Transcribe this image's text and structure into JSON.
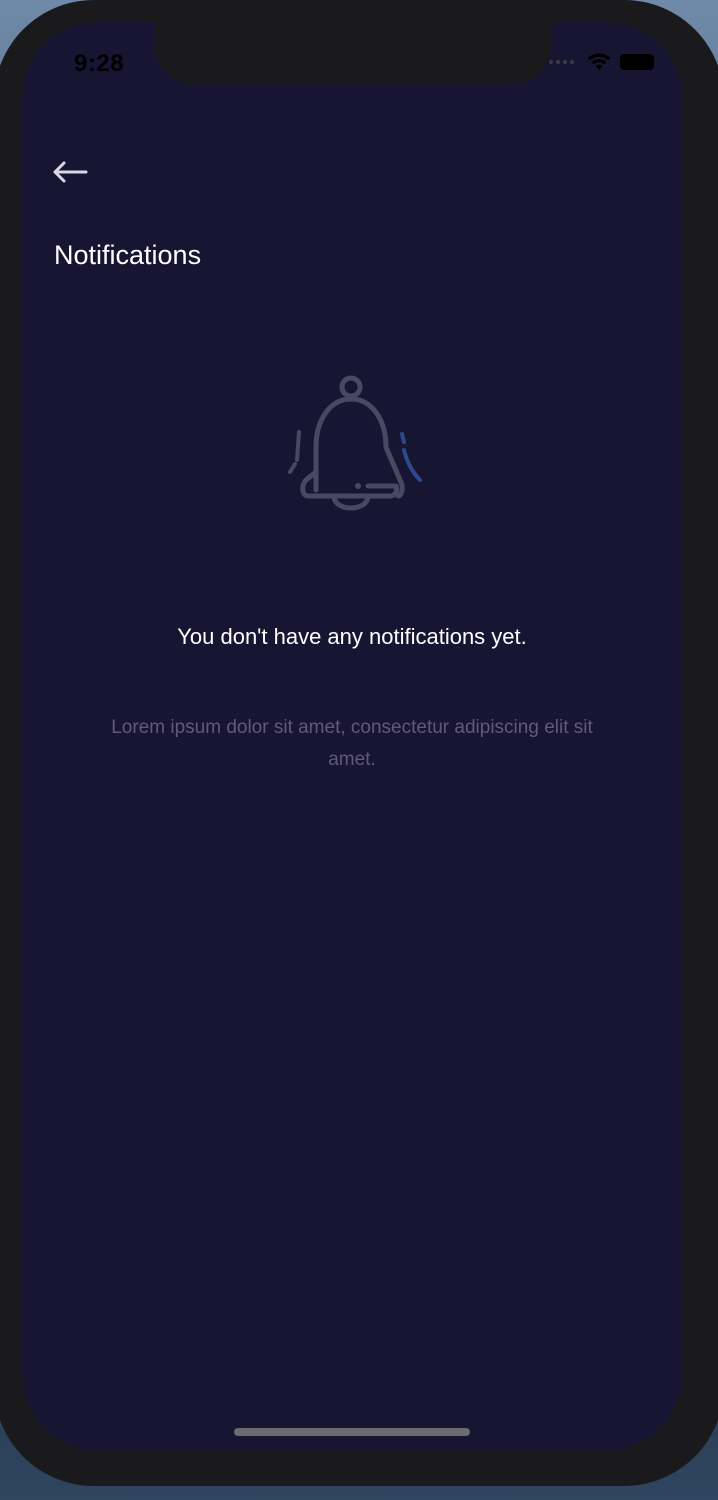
{
  "status_bar": {
    "time": "9:28",
    "icons": [
      "wifi-icon",
      "battery-icon"
    ]
  },
  "header": {
    "back_icon": "arrow-left-icon",
    "title": "Notifications"
  },
  "empty_state": {
    "icon": "bell-icon",
    "title": "You don't have any notifications yet.",
    "description": "Lorem ipsum dolor sit amet, consectetur adipiscing elit sit amet."
  },
  "colors": {
    "background": "#181533",
    "icon_muted": "#4a4760",
    "accent": "#2c4a8a",
    "text_primary": "#ffffff",
    "text_secondary": "#5f5a78"
  }
}
